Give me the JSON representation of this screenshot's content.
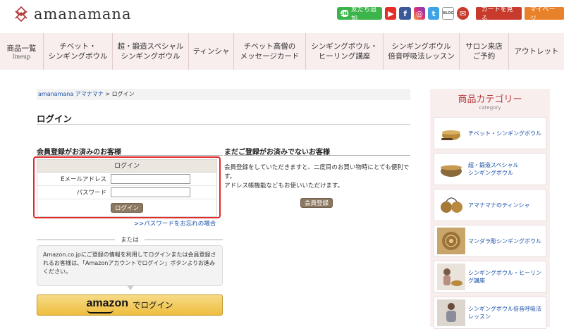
{
  "header": {
    "brand": "amanamana",
    "line_label": "友だち追加",
    "line_mark": "LINE",
    "youtube_glyph": "▶",
    "facebook_glyph": "f",
    "instagram_glyph": "◎",
    "twitter_glyph": "t",
    "blog_glyph": "BLOG",
    "mail_glyph": "✉",
    "cart_label": "カートを見る",
    "mypage_label": "マイページ"
  },
  "nav": {
    "items": [
      {
        "label": "商品一覧",
        "sub": "lineup"
      },
      {
        "label": "チベット・\nシンギングボウル"
      },
      {
        "label": "超・鍛造スペシャル\nシンギングボウル"
      },
      {
        "label": "ティンシャ"
      },
      {
        "label": "チベット高僧の\nメッセージカード"
      },
      {
        "label": "シンギングボウル・\nヒーリング講座"
      },
      {
        "label": "シンギングボウル\n倍音呼吸法レッスン"
      },
      {
        "label": "サロン来店\nご予約"
      },
      {
        "label": "アウトレット"
      }
    ]
  },
  "breadcrumb": {
    "home": "amanamana アマナマナ",
    "sep": ">",
    "current": "ログイン"
  },
  "page_title": "ログイン",
  "member": {
    "heading": "会員登録がお済みのお客様",
    "table_title": "ログイン",
    "email_label": "Eメールアドレス",
    "password_label": "パスワード",
    "email_value": "",
    "password_value": "",
    "login_button": "ログイン",
    "forgot_link": ">>パスワードをお忘れの場合",
    "or_text": "または",
    "amazon_text": "Amazon.co.jpにご登録の情報を利用してログインまたは会員登録されるお客様は、「Amazonアカウントでログイン」ボタンよりお進みください。",
    "amazon_logo": "amazon",
    "amazon_button": "でログイン"
  },
  "nonmember": {
    "heading": "まだご登録がお済みでないお客様",
    "text": "会員登録をしていただきますと、二度目のお買い物時にとても便利です。\nアドレス帳機能などもお使いいただけます。",
    "register_button": "会員登録"
  },
  "sidebar": {
    "title": "商品カテゴリー",
    "subtitle": "category",
    "categories": [
      {
        "label": "チベット・シンギングボウル"
      },
      {
        "label": "超・鍛造スペシャル\nシンギングボウル"
      },
      {
        "label": "アマナマナのティンシャ"
      },
      {
        "label": "マンダラ彫シンギングボウル"
      },
      {
        "label": "シンギングボウル・ヒーリング講座"
      },
      {
        "label": "シンギングボウル倍音呼吸法レッスン"
      }
    ]
  },
  "colors": {
    "accent_red": "#e12a2a",
    "nav_bg": "#f8eeee",
    "brand_red": "#b63a3a",
    "link_blue": "#1a4fa8",
    "brown_button": "#8c7760"
  }
}
